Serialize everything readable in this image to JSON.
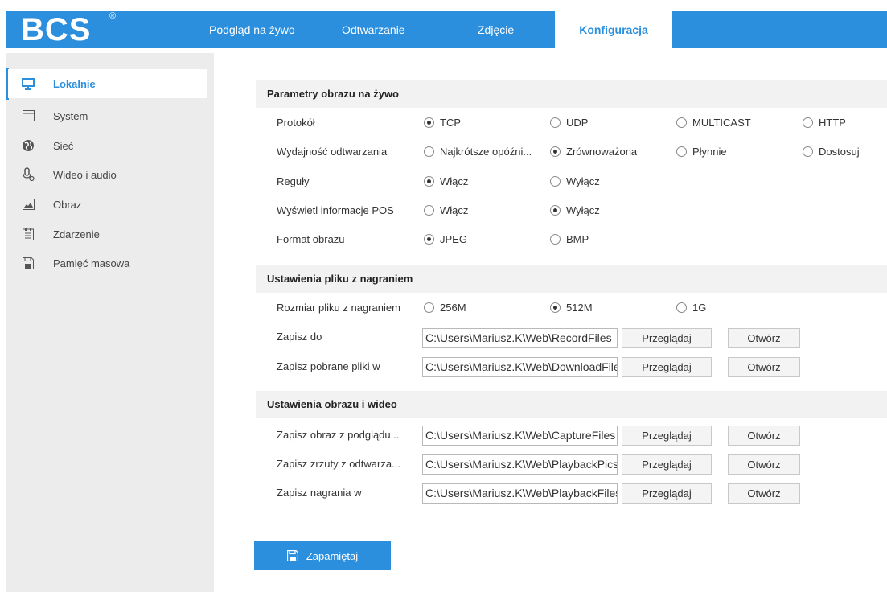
{
  "brand": {
    "logo": "BCS",
    "reg": "®"
  },
  "nav": {
    "live": "Podgląd na żywo",
    "playback": "Odtwarzanie",
    "picture": "Zdjęcie",
    "config": "Konfiguracja"
  },
  "sidebar": {
    "items": [
      {
        "label": "Lokalnie",
        "icon": "monitor-icon"
      },
      {
        "label": "System",
        "icon": "system-icon"
      },
      {
        "label": "Sieć",
        "icon": "globe-icon"
      },
      {
        "label": "Wideo i audio",
        "icon": "microphone-icon"
      },
      {
        "label": "Obraz",
        "icon": "image-icon"
      },
      {
        "label": "Zdarzenie",
        "icon": "event-icon"
      },
      {
        "label": "Pamięć masowa",
        "icon": "storage-icon"
      }
    ]
  },
  "live": {
    "title": "Parametry obrazu na żywo",
    "protocol": {
      "label": "Protokół",
      "options": [
        "TCP",
        "UDP",
        "MULTICAST",
        "HTTP"
      ],
      "selected": "TCP"
    },
    "performance": {
      "label": "Wydajność odtwarzania",
      "options": [
        "Najkrótsze opóźni...",
        "Zrównoważona",
        "Płynnie",
        "Dostosuj"
      ],
      "selected": "Zrównoważona"
    },
    "rules": {
      "label": "Reguły",
      "options": [
        "Włącz",
        "Wyłącz"
      ],
      "selected": "Włącz"
    },
    "pos": {
      "label": "Wyświetl informacje POS",
      "options": [
        "Włącz",
        "Wyłącz"
      ],
      "selected": "Wyłącz"
    },
    "format": {
      "label": "Format obrazu",
      "options": [
        "JPEG",
        "BMP"
      ],
      "selected": "JPEG"
    }
  },
  "record": {
    "title": "Ustawienia pliku z nagraniem",
    "size": {
      "label": "Rozmiar pliku z nagraniem",
      "options": [
        "256M",
        "512M",
        "1G"
      ],
      "selected": "512M"
    },
    "save_to": {
      "label": "Zapisz do",
      "value": "C:\\Users\\Mariusz.K\\Web\\RecordFiles"
    },
    "downloads": {
      "label": "Zapisz pobrane pliki w",
      "value": "C:\\Users\\Mariusz.K\\Web\\DownloadFiles"
    }
  },
  "imgvid": {
    "title": "Ustawienia obrazu i wideo",
    "capture": {
      "label": "Zapisz obraz z podglądu...",
      "value": "C:\\Users\\Mariusz.K\\Web\\CaptureFiles"
    },
    "pb_snap": {
      "label": "Zapisz zrzuty z odtwarza...",
      "value": "C:\\Users\\Mariusz.K\\Web\\PlaybackPics"
    },
    "clips": {
      "label": "Zapisz nagrania w",
      "value": "C:\\Users\\Mariusz.K\\Web\\PlaybackFiles"
    }
  },
  "buttons": {
    "browse": "Przeglądaj",
    "open": "Otwórz",
    "save": "Zapamiętaj"
  },
  "colors": {
    "accent": "#2c8fde",
    "sidebar_bg": "#ececec",
    "section_bg": "#f2f2f2"
  }
}
